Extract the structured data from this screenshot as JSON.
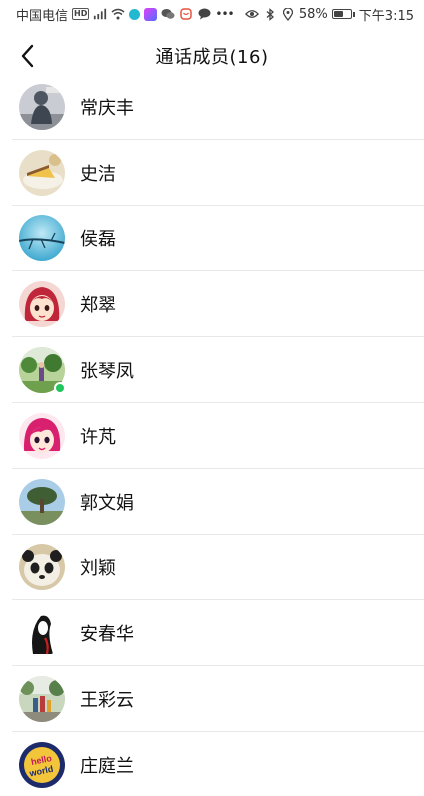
{
  "status_bar": {
    "carrier": "中国电信",
    "network_badge": "HD",
    "signal": "4G",
    "battery_text": "58%",
    "battery_level": 0.58,
    "time": "下午3:15",
    "icons": [
      "signal-icon",
      "wifi-icon",
      "app-notification-icon",
      "wechat-icon",
      "weibo-icon",
      "message-icon",
      "more-dots-icon",
      "eye-icon",
      "bluetooth-icon",
      "location-icon",
      "battery-icon"
    ]
  },
  "header": {
    "title": "通话成员(16)",
    "back_icon": "chevron-left-icon"
  },
  "members": [
    {
      "name": "常庆丰",
      "avatar": "statue-photo"
    },
    {
      "name": "史洁",
      "avatar": "cake-photo"
    },
    {
      "name": "侯磊",
      "avatar": "branch-sky-photo"
    },
    {
      "name": "郑翠",
      "avatar": "cartoon-girl-red"
    },
    {
      "name": "张琴凤",
      "avatar": "garden-photo",
      "badge": "online"
    },
    {
      "name": "许芃",
      "avatar": "cartoon-girl-pink"
    },
    {
      "name": "郭文娟",
      "avatar": "tree-photo"
    },
    {
      "name": "刘颖",
      "avatar": "panda-photo"
    },
    {
      "name": "安春华",
      "avatar": "ink-figure-drawing"
    },
    {
      "name": "王彩云",
      "avatar": "family-outdoor-photo"
    },
    {
      "name": "庄庭兰",
      "avatar": "hello-world-text-art"
    }
  ],
  "colors": {
    "divider": "#e8e8e8",
    "online": "#22c55e",
    "text": "#111111"
  }
}
